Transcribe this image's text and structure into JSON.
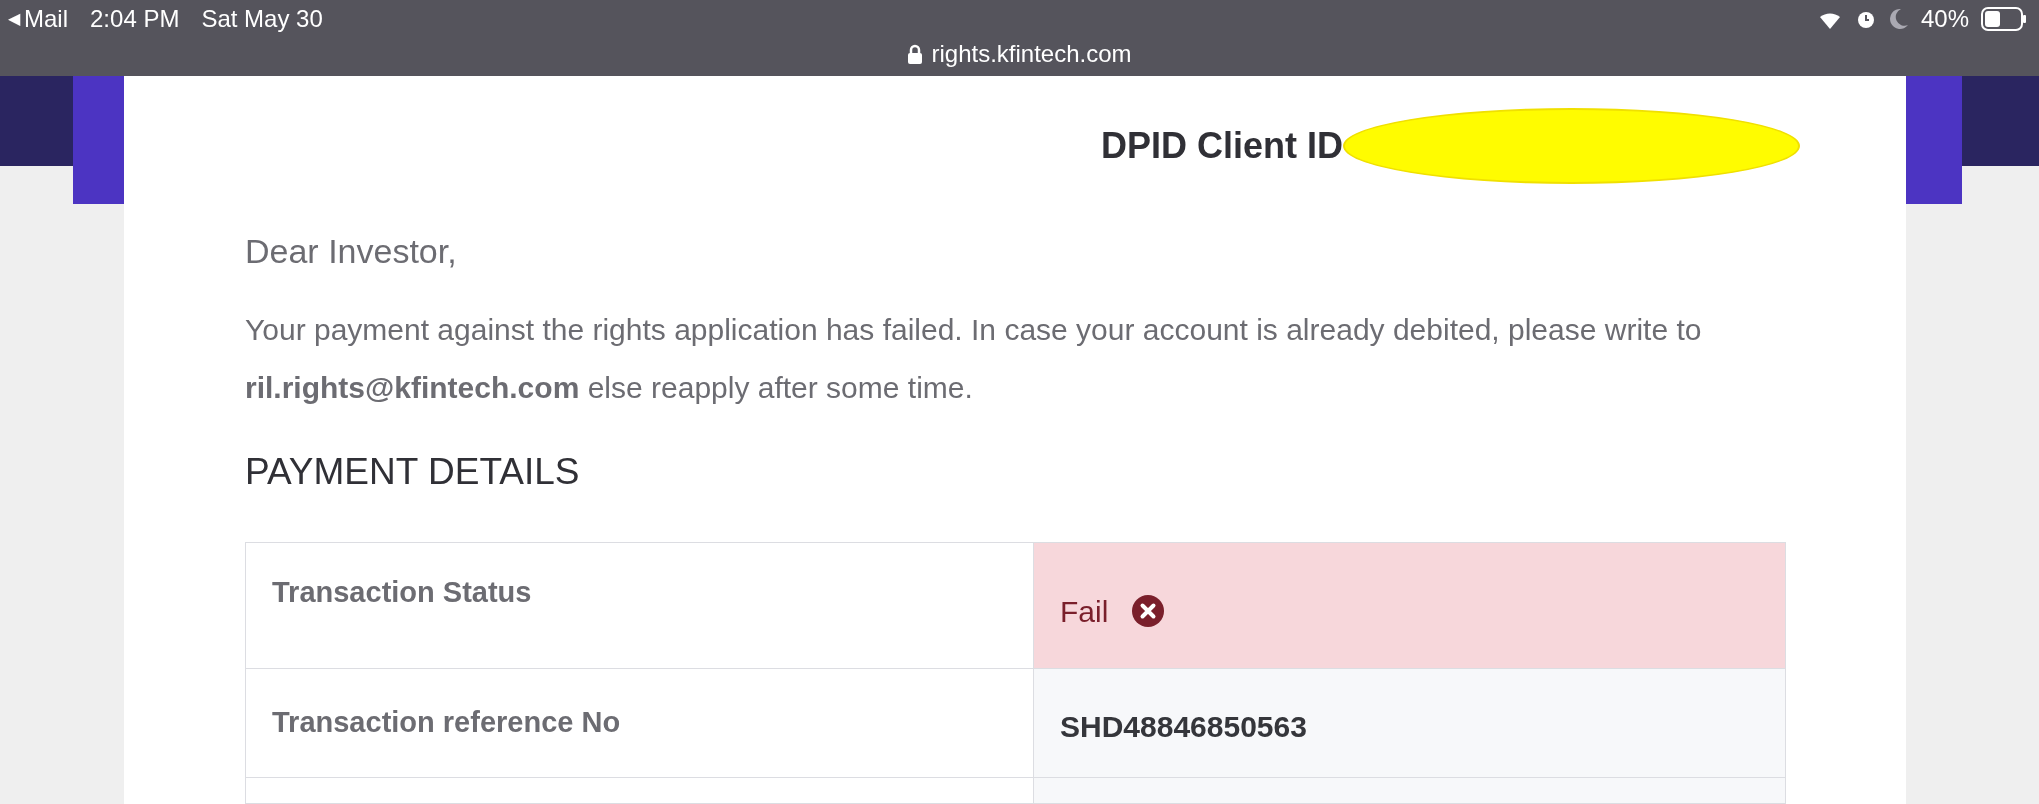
{
  "status_bar": {
    "back_arrow": "◀",
    "back_app": "Mail",
    "time": "2:04 PM",
    "date": "Sat May 30",
    "battery": "40%",
    "url": "rights.kfintech.com"
  },
  "header": {
    "label": "DPID Client ID",
    "redacted": true
  },
  "greeting": "Dear Investor,",
  "message": "Your payment against the rights application has failed. In case your account is already debited, please write to **ril.rights@kfintech.com** else reapply after some time.",
  "section_title": "PAYMENT DETAILS",
  "table": {
    "rows": [
      {
        "kind": "status",
        "label": "Transaction Status",
        "value": "Fail"
      },
      {
        "kind": "text",
        "label": "Transaction reference No",
        "value": "SHD48846850563"
      }
    ]
  }
}
